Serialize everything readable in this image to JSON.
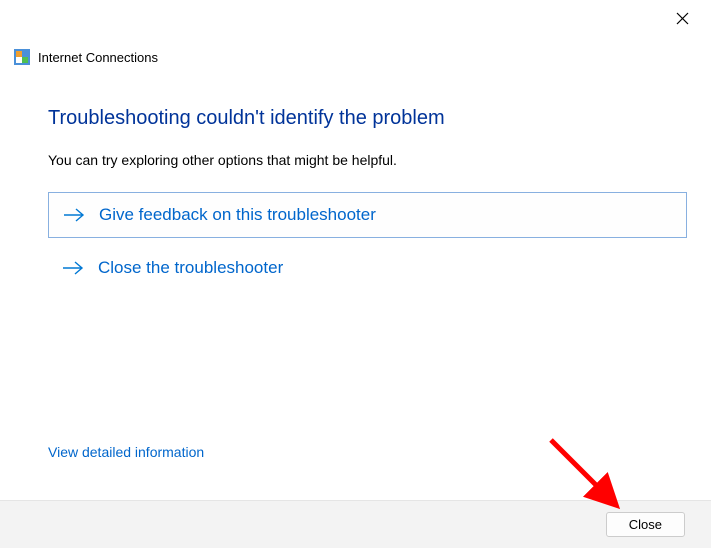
{
  "window": {
    "title": "Internet Connections"
  },
  "main": {
    "heading": "Troubleshooting couldn't identify the problem",
    "subtext": "You can try exploring other options that might be helpful.",
    "options": [
      {
        "label": "Give feedback on this troubleshooter",
        "selected": true
      },
      {
        "label": "Close the troubleshooter",
        "selected": false
      }
    ],
    "detailed_link": "View detailed information"
  },
  "footer": {
    "close_label": "Close"
  }
}
